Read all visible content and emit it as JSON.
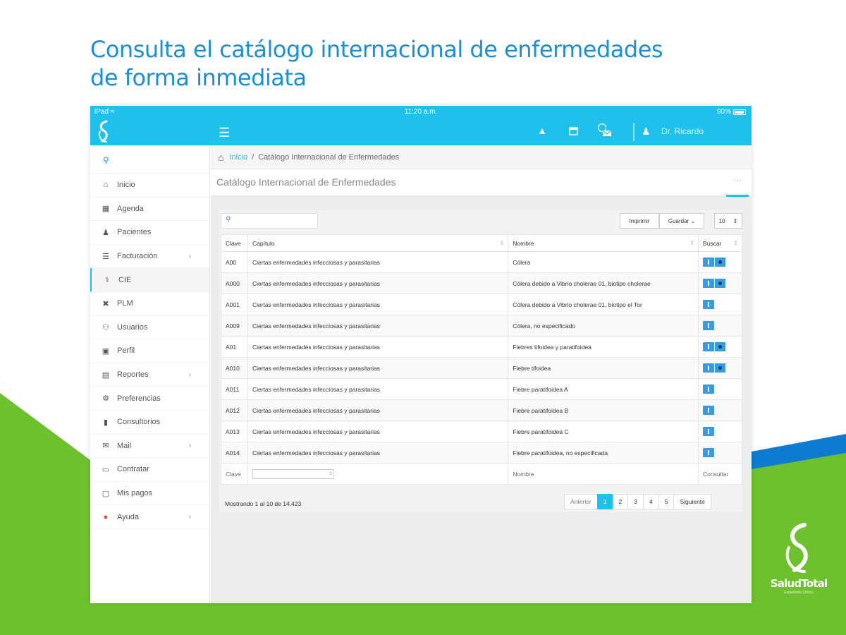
{
  "headline": {
    "line1": "Consulta el catálogo internacional de enfermedades",
    "line2": "de forma inmediata"
  },
  "colors": {
    "accent": "#1ec1ec",
    "headline": "#1a8fd6",
    "green": "#6cc12c",
    "blue": "#0f7bd0"
  },
  "statusbar": {
    "device": "iPad",
    "time": "11:20 a.m.",
    "battery": "90%",
    "battery_level": 0.9
  },
  "topbar": {
    "user_name": "Dr. Ricardo",
    "icons": [
      "alert-icon",
      "calendar-icon",
      "clock-mail-icon",
      "user-icon"
    ]
  },
  "sidebar": {
    "items": [
      {
        "label": "Inicio",
        "icon": "home-icon"
      },
      {
        "label": "Agenda",
        "icon": "calendar-icon"
      },
      {
        "label": "Pacientes",
        "icon": "patient-icon"
      },
      {
        "label": "Facturación",
        "icon": "invoice-icon",
        "has_submenu": true
      },
      {
        "label": "CIE",
        "icon": "stethoscope-icon",
        "active": true
      },
      {
        "label": "PLM",
        "icon": "medkit-icon"
      },
      {
        "label": "Usuarios",
        "icon": "users-icon"
      },
      {
        "label": "Perfil",
        "icon": "profile-icon"
      },
      {
        "label": "Reportes",
        "icon": "reports-icon",
        "has_submenu": true
      },
      {
        "label": "Preferencias",
        "icon": "gear-icon"
      },
      {
        "label": "Consultorios",
        "icon": "building-icon"
      },
      {
        "label": "Mail",
        "icon": "mail-icon",
        "has_submenu": true
      },
      {
        "label": "Contratar",
        "icon": "card-icon"
      },
      {
        "label": "Mis pagos",
        "icon": "payments-icon"
      },
      {
        "label": "Ayuda",
        "icon": "help-icon",
        "has_submenu": true
      }
    ]
  },
  "breadcrumb": {
    "home_label": "Inicio",
    "separator": "/",
    "current": "Catálogo Internacional de Enfermedades"
  },
  "page": {
    "title": "Catálogo Internacional de Enfermedades",
    "more": "···"
  },
  "toolbar": {
    "print_label": "Imprimir",
    "save_label": "Guardar",
    "page_size": "10"
  },
  "table": {
    "headers": [
      "Clave",
      "Capítulo",
      "Nombre",
      "Buscar"
    ],
    "rows": [
      {
        "clave": "A00",
        "capitulo": "Ciertas enfermedades infecciosas y parasitarias",
        "nombre": "Cólera",
        "extra": true
      },
      {
        "clave": "A000",
        "capitulo": "Ciertas enfermedades infecciosas y parasitarias",
        "nombre": "Cólera debido a Vibrio cholerae 01, biotipo cholerae",
        "extra": true
      },
      {
        "clave": "A001",
        "capitulo": "Ciertas enfermedades infecciosas y parasitarias",
        "nombre": "Cólera debido a Vibrio cholerae 01, biotipo el Tor",
        "extra": false
      },
      {
        "clave": "A009",
        "capitulo": "Ciertas enfermedades infecciosas y parasitarias",
        "nombre": "Cólera, no especificado",
        "extra": false
      },
      {
        "clave": "A01",
        "capitulo": "Ciertas enfermedades infecciosas y parasitarias",
        "nombre": "Fiebres tifoidea y paratifoidea",
        "extra": true
      },
      {
        "clave": "A010",
        "capitulo": "Ciertas enfermedades infecciosas y parasitarias",
        "nombre": "Fiebre tifoidea",
        "extra": true
      },
      {
        "clave": "A011",
        "capitulo": "Ciertas enfermedades infecciosas y parasitarias",
        "nombre": "Fiebre paratifoidea A",
        "extra": false
      },
      {
        "clave": "A012",
        "capitulo": "Ciertas enfermedades infecciosas y parasitarias",
        "nombre": "Fiebre paratifoidea B",
        "extra": false
      },
      {
        "clave": "A013",
        "capitulo": "Ciertas enfermedades infecciosas y parasitarias",
        "nombre": "Fiebre paratifoidea C",
        "extra": false
      },
      {
        "clave": "A014",
        "capitulo": "Ciertas enfermedades infecciosas y parasitarias",
        "nombre": "Fiebre paratifoidea, no especificada",
        "extra": false
      }
    ],
    "footer": {
      "clave": "Clave",
      "nombre": "Nombre",
      "action": "Consultar"
    }
  },
  "pagination": {
    "info": "Mostrando 1 al 10 de 14,423",
    "prev": "Anterior",
    "pages": [
      "1",
      "2",
      "3",
      "4",
      "5"
    ],
    "current": "1",
    "next": "Siguiente"
  },
  "brand": {
    "name": "SaludTotal",
    "subtitle": "Expediente Clínico"
  }
}
